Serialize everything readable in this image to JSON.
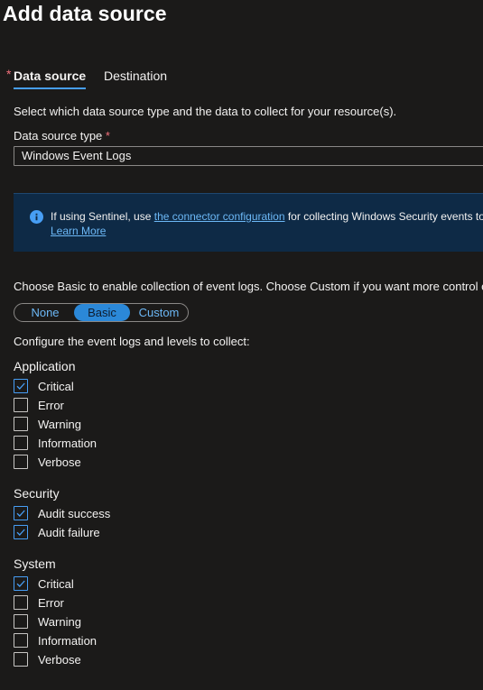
{
  "title": "Add data source",
  "tabs": {
    "data_source": "Data source",
    "destination": "Destination",
    "required_marker": "*"
  },
  "intro": "Select which data source type and the data to collect for your resource(s).",
  "data_source_type": {
    "label": "Data source type",
    "required_marker": "*",
    "value": "Windows Event Logs"
  },
  "info": {
    "text_before": "If using Sentinel, use ",
    "link": "the connector configuration",
    "text_after": " for collecting Windows Security events to",
    "learn_more": "Learn More"
  },
  "choose_text": "Choose Basic to enable collection of event logs. Choose Custom if you want more control o",
  "mode": {
    "options": [
      "None",
      "Basic",
      "Custom"
    ],
    "selected": "Basic"
  },
  "configure_text": "Configure the event logs and levels to collect:",
  "groups": {
    "application": {
      "title": "Application",
      "items": [
        {
          "label": "Critical",
          "checked": true
        },
        {
          "label": "Error",
          "checked": false
        },
        {
          "label": "Warning",
          "checked": false
        },
        {
          "label": "Information",
          "checked": false
        },
        {
          "label": "Verbose",
          "checked": false
        }
      ]
    },
    "security": {
      "title": "Security",
      "items": [
        {
          "label": "Audit success",
          "checked": true
        },
        {
          "label": "Audit failure",
          "checked": true
        }
      ]
    },
    "system": {
      "title": "System",
      "items": [
        {
          "label": "Critical",
          "checked": true
        },
        {
          "label": "Error",
          "checked": false
        },
        {
          "label": "Warning",
          "checked": false
        },
        {
          "label": "Information",
          "checked": false
        },
        {
          "label": "Verbose",
          "checked": false
        }
      ]
    }
  },
  "colors": {
    "background": "#1b1a19",
    "accent": "#479ef5",
    "link": "#6cb8f6",
    "info_bg": "#0e2a46",
    "required": "#f1707b"
  }
}
